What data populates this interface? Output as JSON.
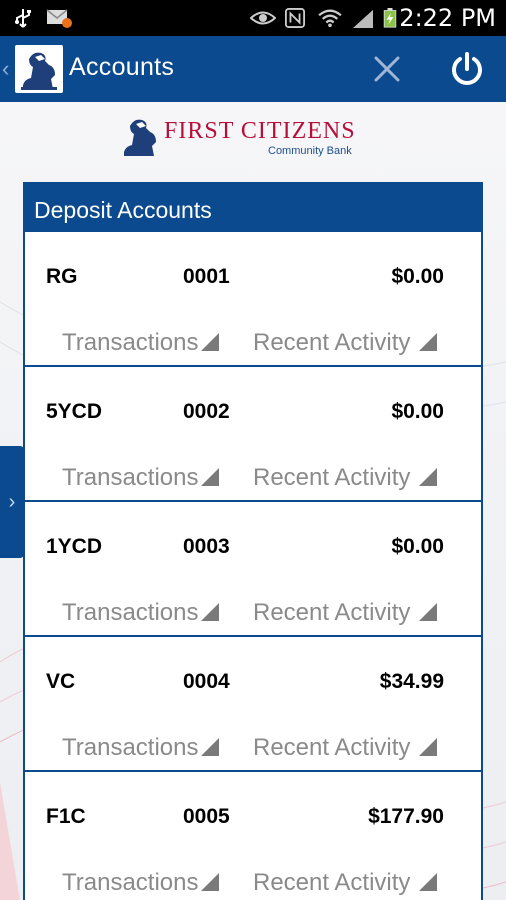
{
  "status_bar": {
    "time": "2:22 PM"
  },
  "header": {
    "title": "Accounts"
  },
  "brand": {
    "name": "First Citizens",
    "subtitle": "Community Bank"
  },
  "section": {
    "title": "Deposit Accounts"
  },
  "accounts": [
    {
      "type": "RG",
      "number": "0001",
      "balance": "$0.00"
    },
    {
      "type": "5YCD",
      "number": "0002",
      "balance": "$0.00"
    },
    {
      "type": "1YCD",
      "number": "0003",
      "balance": "$0.00"
    },
    {
      "type": "VC",
      "number": "0004",
      "balance": "$34.99"
    },
    {
      "type": "F1C",
      "number": "0005",
      "balance": "$177.90"
    }
  ],
  "links": {
    "transactions": "Transactions",
    "recent_activity": "Recent Activity"
  },
  "colors": {
    "brand_blue": "#0b4a8e",
    "brand_red": "#b5103a"
  }
}
